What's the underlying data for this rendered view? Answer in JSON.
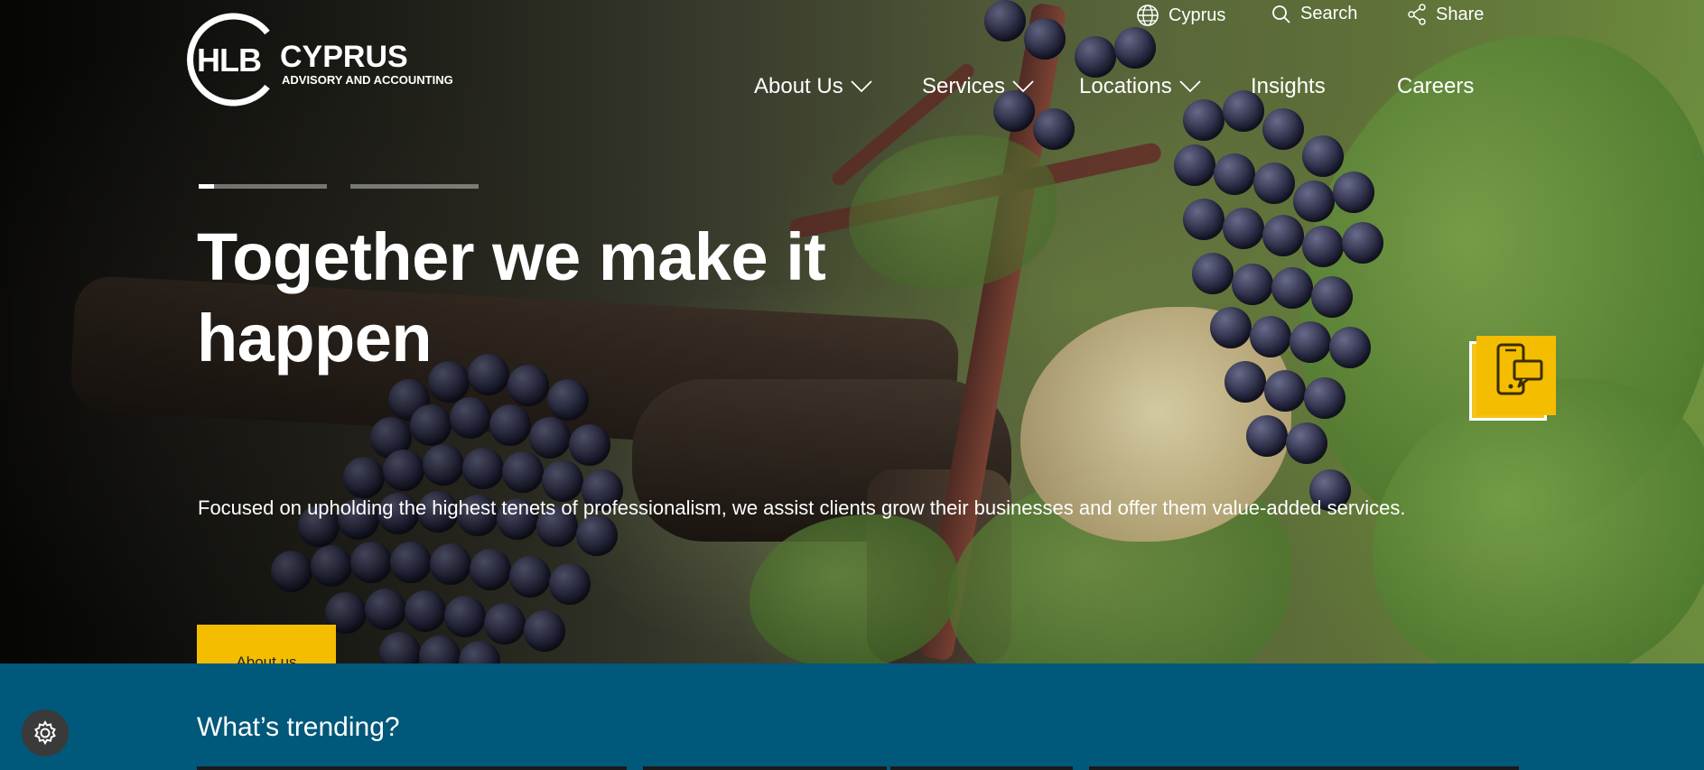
{
  "brand": {
    "logo_mark": "HLB",
    "logo_name": "CYPRUS",
    "logo_tagline": "ADVISORY AND ACCOUNTING"
  },
  "utility_nav": {
    "region_label": "Cyprus",
    "search_label": "Search",
    "share_label": "Share"
  },
  "main_nav": {
    "items": [
      {
        "label": "About Us",
        "has_dropdown": true
      },
      {
        "label": "Services",
        "has_dropdown": true
      },
      {
        "label": "Locations",
        "has_dropdown": true
      },
      {
        "label": "Insights",
        "has_dropdown": false
      },
      {
        "label": "Careers",
        "has_dropdown": false
      }
    ]
  },
  "hero": {
    "headline": "Together we make it happen",
    "subtext": "Focused on upholding the highest tenets of professionalism, we assist clients grow their businesses and offer them value-added services.",
    "cta_label": "About us",
    "slides_total": 2,
    "active_slide": 1,
    "active_slide_progress": 0.12
  },
  "trending": {
    "title": "What’s trending?"
  },
  "colors": {
    "accent_yellow": "#f5bd00",
    "trending_bg": "#00587a",
    "text_white": "#ffffff"
  },
  "icons": [
    "globe-icon",
    "search-icon",
    "share-icon",
    "chevron-down-icon",
    "mobile-chat-icon",
    "gear-icon"
  ]
}
